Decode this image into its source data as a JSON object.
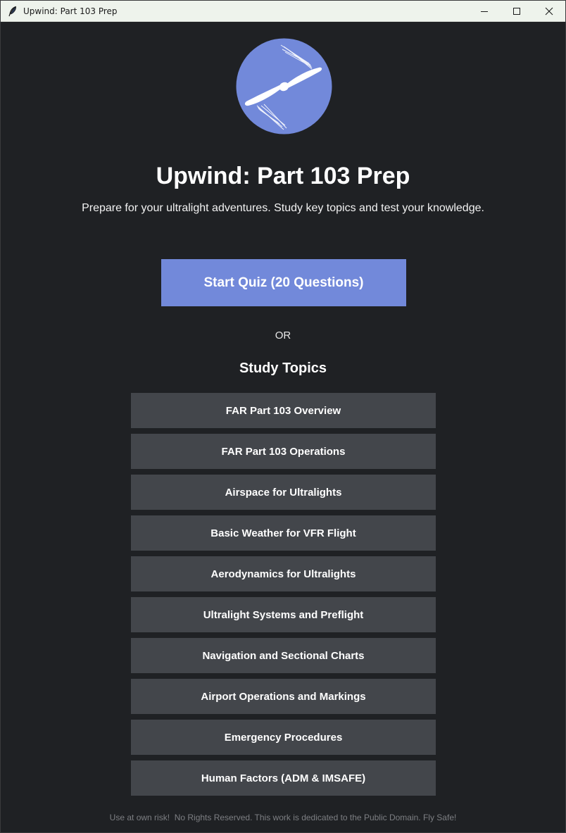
{
  "window": {
    "title": "Upwind: Part 103 Prep",
    "icon": "feather-icon"
  },
  "header": {
    "logo_icon": "propeller-logo-icon",
    "title": "Upwind: Part 103 Prep",
    "subtitle": "Prepare for your ultralight adventures. Study key topics and test your knowledge."
  },
  "quiz": {
    "start_label": "Start Quiz (20 Questions)"
  },
  "separator": "OR",
  "study": {
    "heading": "Study Topics",
    "topics": [
      "FAR Part 103 Overview",
      "FAR Part 103 Operations",
      "Airspace for Ultralights",
      "Basic Weather for VFR Flight",
      "Aerodynamics for Ultralights",
      "Ultralight Systems and Preflight",
      "Navigation and Sectional Charts",
      "Airport Operations and Markings",
      "Emergency Procedures",
      "Human Factors (ADM & IMSAFE)"
    ]
  },
  "footer": "Use at own risk!  No Rights Reserved. This work is dedicated to the Public Domain. Fly Safe!",
  "colors": {
    "background": "#1f2124",
    "accent": "#7289da",
    "topic_button": "#43464b",
    "footer_text": "#7d7f83"
  }
}
